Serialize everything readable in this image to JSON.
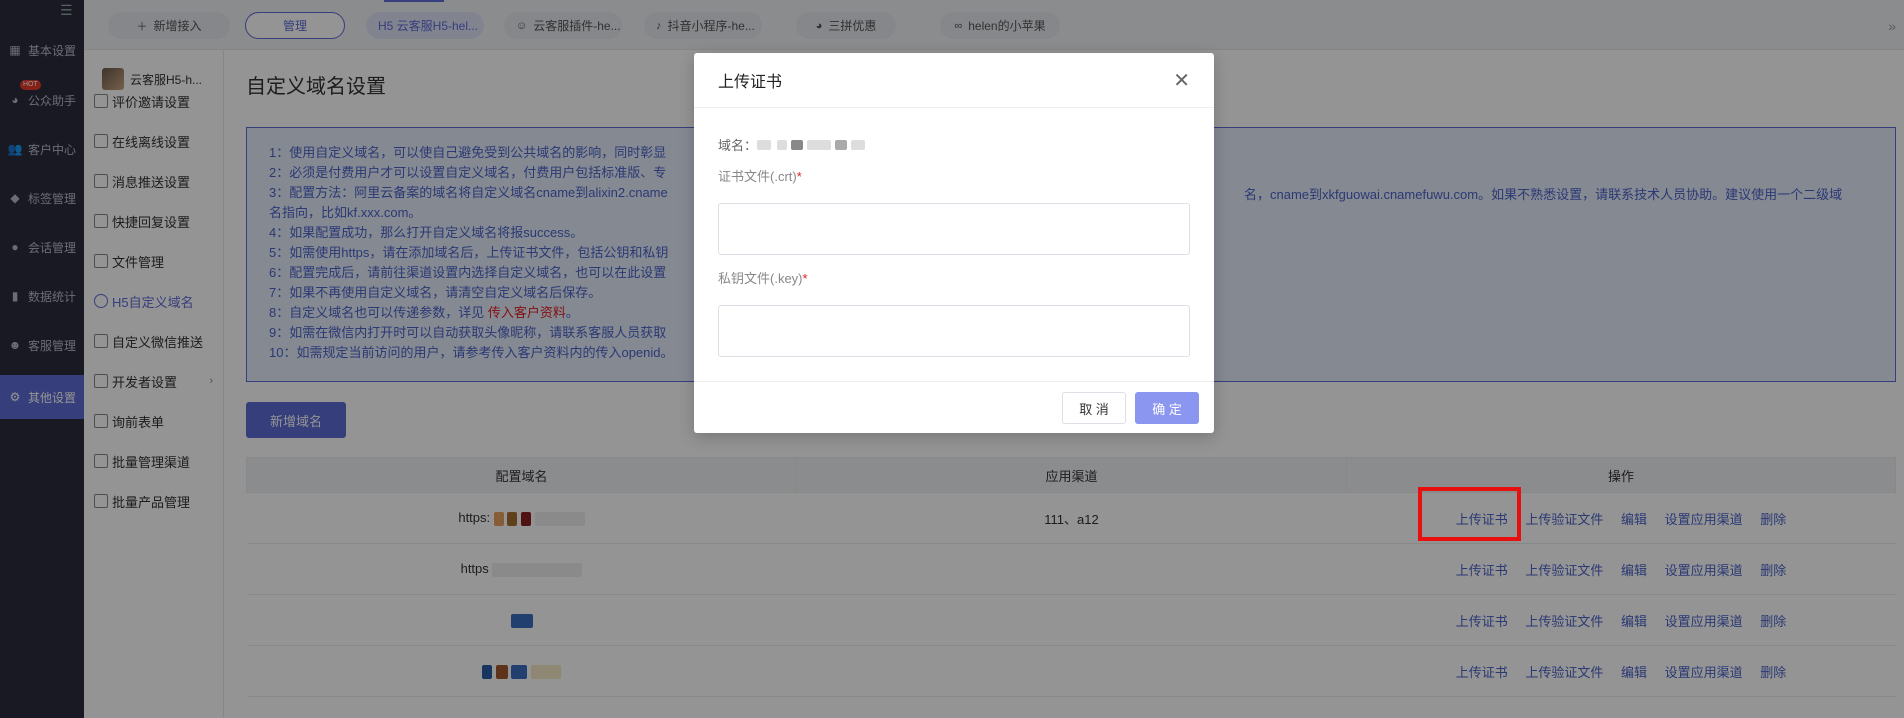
{
  "sidebar": {
    "hot_badge": "HOT",
    "items": [
      {
        "label": "基本设置",
        "icon": "grid-icon"
      },
      {
        "label": "公众助手",
        "icon": "wechat-icon"
      },
      {
        "label": "客户中心",
        "icon": "users-icon"
      },
      {
        "label": "标签管理",
        "icon": "tag-icon"
      },
      {
        "label": "会话管理",
        "icon": "chat-icon"
      },
      {
        "label": "数据统计",
        "icon": "chart-icon"
      },
      {
        "label": "客服管理",
        "icon": "headset-icon"
      },
      {
        "label": "其他设置",
        "icon": "gear-icon"
      }
    ]
  },
  "topbar": {
    "add_label": "新增接入",
    "manage_label": "管理",
    "tabs": [
      "H5 云客服H5-hel...",
      "云客服插件-he...",
      "抖音小程序-he...",
      "三拼优惠",
      "helen的小苹果"
    ]
  },
  "subnav": {
    "head": "云客服H5-h...",
    "items": [
      "评价邀请设置",
      "在线离线设置",
      "消息推送设置",
      "快捷回复设置",
      "文件管理",
      "H5自定义域名",
      "自定义微信推送",
      "开发者设置",
      "询前表单",
      "批量管理渠道",
      "批量产品管理"
    ]
  },
  "main": {
    "title": "自定义域名设置",
    "notice": [
      "1：使用自定义域名，可以使自己避免受到公共域名的影响，同时彰显",
      "2：必须是付费用户才可以设置自定义域名，付费用户包括标准版、专",
      "3：配置方法：阿里云备案的域名将自定义域名cname到alixin2.cname",
      "名指向，比如kf.xxx.com。",
      "4：如果配置成功，那么打开自定义域名将报success。",
      "5：如需使用https，请在添加域名后，上传证书文件，包括公钥和私钥",
      "6：配置完成后，请前往渠道设置内选择自定义域名，也可以在此设置",
      "7：如果不再使用自定义域名，请清空自定义域名后保存。",
      "8：自定义域名也可以传递参数，详见 ",
      "9：如需在微信内打开时可以自动获取头像昵称，请联系客服人员获取",
      "10：如需规定当前访问的用户，请参考传入客户资料内的传入openid。"
    ],
    "notice_link": "传入客户资料",
    "notice_right": "名，cname到xkfguowai.cnamefuwu.com。如果不熟悉设置，请联系技术人员协助。建议使用一个二级域",
    "new_domain_button": "新增域名",
    "table": {
      "headers": [
        "配置域名",
        "应用渠道",
        "操作"
      ],
      "rows": [
        {
          "domain": "https:",
          "channel": "111、a12"
        },
        {
          "domain": "https",
          "channel": ""
        },
        {
          "domain": "",
          "channel": ""
        },
        {
          "domain": "",
          "channel": ""
        }
      ],
      "ops": [
        "上传证书",
        "上传验证文件",
        "编辑",
        "设置应用渠道",
        "删除"
      ]
    }
  },
  "modal": {
    "title": "上传证书",
    "domain_label": "域名：",
    "cert_label": "证书文件(.crt)",
    "key_label": "私钥文件(.key)",
    "required_mark": "*",
    "cancel": "取 消",
    "ok": "确 定"
  }
}
